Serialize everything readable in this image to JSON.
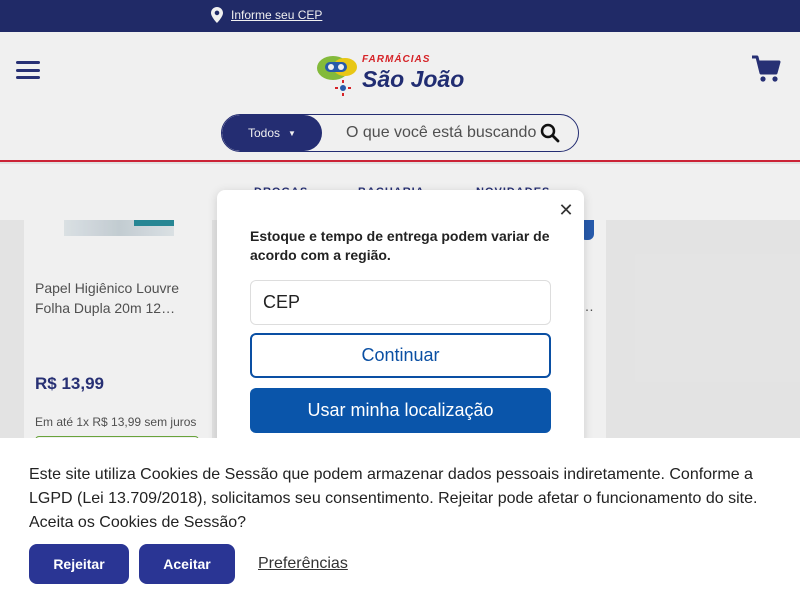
{
  "topbar": {
    "cep_label": "Informe seu CEP"
  },
  "header": {
    "logo_small": "FARMÁCIAS",
    "logo_main": "São João",
    "search_category": "Todos",
    "search_placeholder": "O que você está buscando?"
  },
  "nav": {
    "items": [
      "DROGAS",
      "BACHARIA",
      "NOVIDADES"
    ]
  },
  "product": {
    "name": "Papel Higiênico Louvre Folha Dupla 20m 12…",
    "price": "R$ 13,99",
    "installment": "Em até 1x R$ 13,99 sem juros",
    "name_2": "…"
  },
  "modal": {
    "text": "Estoque e tempo de entrega podem variar de acordo com a região.",
    "cep_placeholder": "CEP",
    "continue_label": "Continuar",
    "location_label": "Usar minha localização",
    "close_symbol": "✕"
  },
  "cookie": {
    "text": "Este site utiliza Cookies de Sessão que podem armazenar dados pessoais indiretamente. Conforme a LGPD (Lei 13.709/2018), solicitamos seu consentimento. Rejeitar pode afetar o funcionamento do site. Aceita os Cookies de Sessão?",
    "reject_label": "Rejeitar",
    "accept_label": "Aceitar",
    "prefs_label": "Preferências"
  },
  "colors": {
    "brand_blue": "#2a347c",
    "brand_red": "#d8263a",
    "action_blue": "#0a55aa",
    "cookie_button": "#2a3594"
  }
}
